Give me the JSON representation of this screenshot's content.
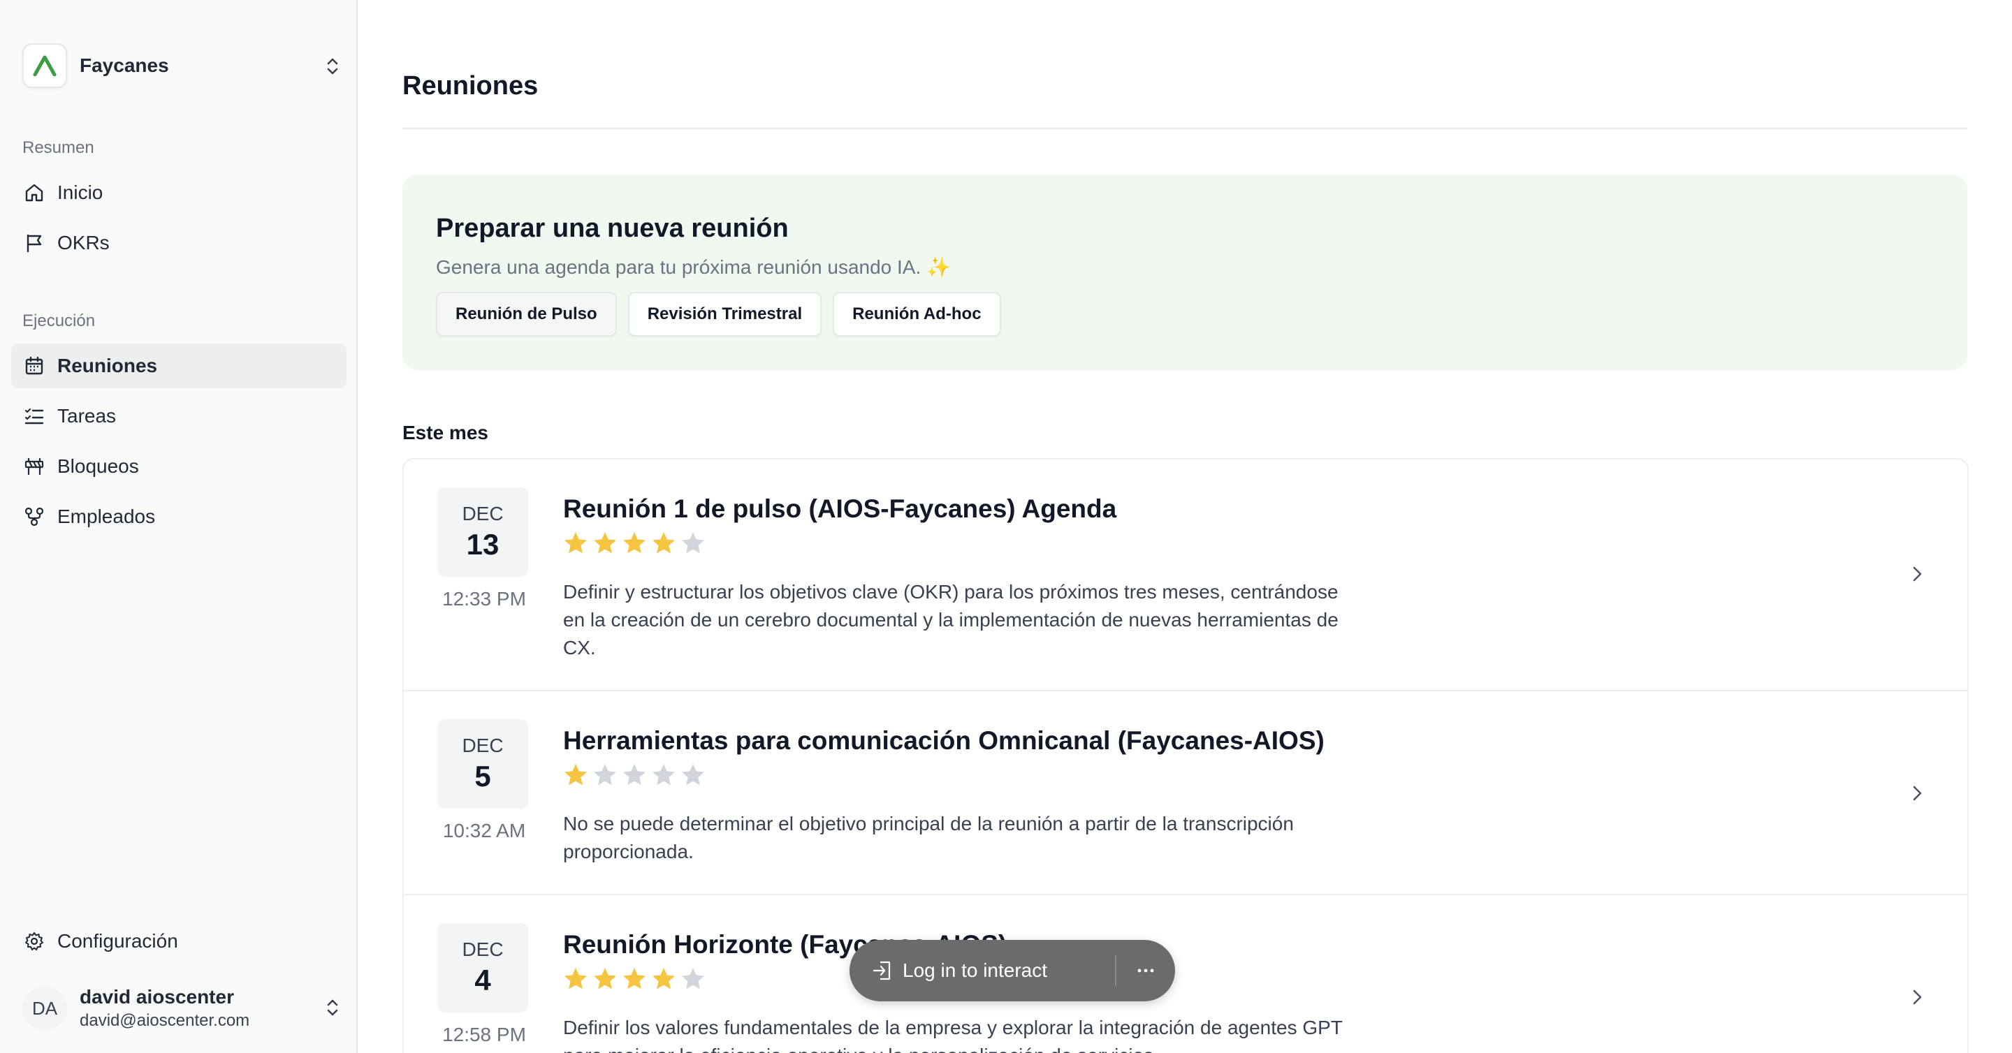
{
  "workspace": {
    "name": "Faycanes"
  },
  "sidebar": {
    "groups": [
      {
        "label": "Resumen",
        "items": [
          {
            "label": "Inicio",
            "icon": "home-icon"
          },
          {
            "label": "OKRs",
            "icon": "flag-icon"
          }
        ]
      },
      {
        "label": "Ejecución",
        "items": [
          {
            "label": "Reuniones",
            "icon": "calendar-icon",
            "active": true
          },
          {
            "label": "Tareas",
            "icon": "task-list-icon"
          },
          {
            "label": "Bloqueos",
            "icon": "roadblock-icon"
          },
          {
            "label": "Empleados",
            "icon": "people-network-icon"
          }
        ]
      }
    ],
    "settings_label": "Configuración",
    "user": {
      "initials": "DA",
      "name": "david aioscenter",
      "email": "david@aioscenter.com"
    }
  },
  "main": {
    "title": "Reuniones",
    "prepare": {
      "title": "Preparar una nueva reunión",
      "subtitle": "Genera una agenda para tu próxima reunión usando IA. ✨",
      "buttons": [
        "Reunión de Pulso",
        "Revisión Trimestral",
        "Reunión Ad-hoc"
      ]
    },
    "section_label": "Este mes",
    "meetings": [
      {
        "month": "DEC",
        "day": "13",
        "time": "12:33 PM",
        "title": "Reunión 1 de pulso (AIOS-Faycanes) Agenda",
        "rating": 4,
        "rating_max": 5,
        "description": "Definir y estructurar los objetivos clave (OKR) para los próximos tres meses, centrándose en la creación de un cerebro documental y la implementación de nuevas herramientas de CX."
      },
      {
        "month": "DEC",
        "day": "5",
        "time": "10:32 AM",
        "title": "Herramientas para comunicación Omnicanal (Faycanes-AIOS)",
        "rating": 1,
        "rating_max": 5,
        "description": "No se puede determinar el objetivo principal de la reunión a partir de la transcripción proporcionada."
      },
      {
        "month": "DEC",
        "day": "4",
        "time": "12:58 PM",
        "title": "Reunión Horizonte (Faycanes-AIOS)",
        "rating": 4,
        "rating_max": 5,
        "description": "Definir los valores fundamentales de la empresa y explorar la integración de agentes GPT para mejorar la eficiencia operativa y la personalización de servicios."
      }
    ]
  },
  "overlay": {
    "login_label": "Log in to interact"
  },
  "colors": {
    "accent_green": "#3a9d44",
    "star_filled": "#f5c542",
    "star_empty": "#d1d5db",
    "prepare_bg": "#f1f8f0"
  }
}
